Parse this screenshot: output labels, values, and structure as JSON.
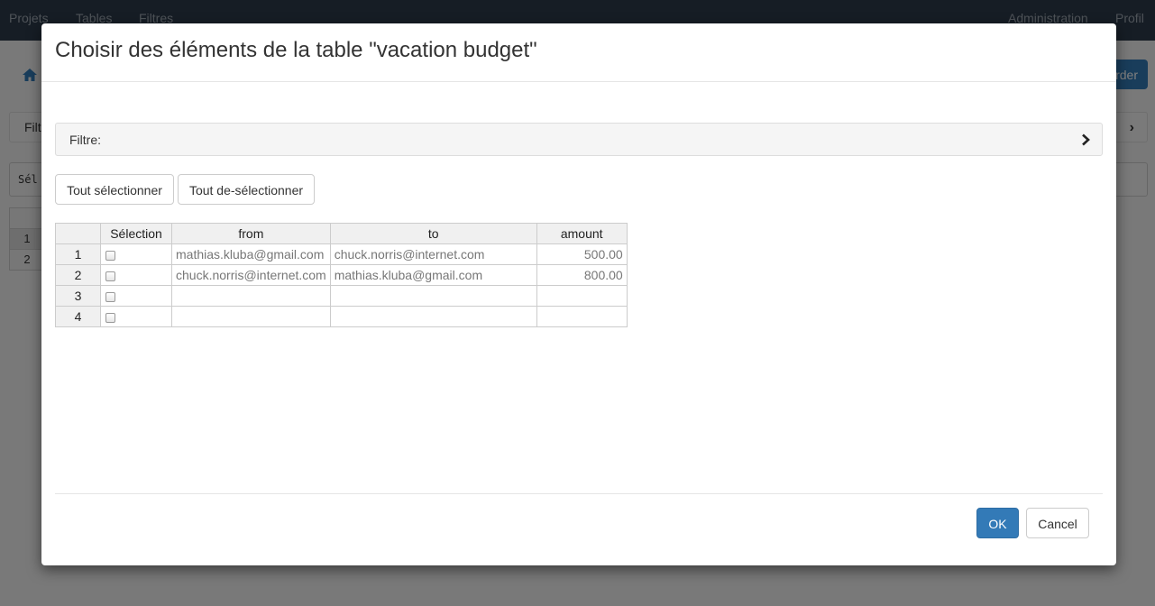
{
  "navbar": {
    "items_left": [
      "Projets",
      "Tables",
      "Filtres"
    ],
    "items_right": [
      "Administration",
      "Profil"
    ]
  },
  "background": {
    "save_button_fragment": "rder",
    "filter_fragment": "Filt",
    "selection_fragment": "Sél",
    "row_numbers": [
      "1",
      "2"
    ]
  },
  "modal": {
    "title": "Choisir des éléments de la table \"vacation budget\"",
    "filter_label": "Filtre:",
    "select_all_label": "Tout sélectionner",
    "deselect_all_label": "Tout de-sélectionner",
    "table": {
      "columns": [
        "Sélection",
        "from",
        "to",
        "amount"
      ],
      "rows": [
        {
          "num": "1",
          "checked": false,
          "from": "mathias.kluba@gmail.com",
          "to": "chuck.norris@internet.com",
          "amount": "500.00"
        },
        {
          "num": "2",
          "checked": false,
          "from": "chuck.norris@internet.com",
          "to": "mathias.kluba@gmail.com",
          "amount": "800.00"
        },
        {
          "num": "3",
          "checked": false,
          "from": "",
          "to": "",
          "amount": ""
        },
        {
          "num": "4",
          "checked": false,
          "from": "",
          "to": "",
          "amount": ""
        }
      ]
    },
    "ok_label": "OK",
    "cancel_label": "Cancel"
  },
  "colors": {
    "primary": "#337ab7",
    "navbar": "#2d3b4b"
  }
}
